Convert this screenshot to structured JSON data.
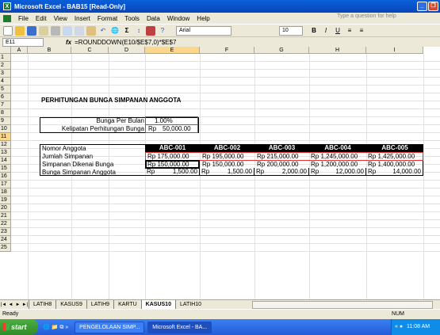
{
  "window": {
    "title": "Microsoft Excel - BAB15  [Read-Only]",
    "app_icon": "excel-icon"
  },
  "menu": {
    "items": [
      "File",
      "Edit",
      "View",
      "Insert",
      "Format",
      "Tools",
      "Data",
      "Window",
      "Help"
    ],
    "help_placeholder": "Type a question for help"
  },
  "toolbar": {
    "font_name": "Arial",
    "font_size": "10",
    "bold": "B",
    "italic": "I",
    "underline": "U"
  },
  "formula_bar": {
    "name_box": "E11",
    "fx": "fx",
    "formula": "=ROUNDDOWN(E10/$E$7,0)*$E$7"
  },
  "columns": [
    "A",
    "B",
    "C",
    "D",
    "E",
    "F",
    "G",
    "H",
    "I"
  ],
  "rows": [
    "1",
    "2",
    "3",
    "4",
    "5",
    "6",
    "7",
    "8",
    "9",
    "10",
    "11",
    "12",
    "13",
    "14",
    "15",
    "16",
    "17",
    "18",
    "19",
    "20",
    "21",
    "22",
    "23",
    "24",
    "25"
  ],
  "sheet": {
    "title": "PERHITUNGAN BUNGA SIMPANAN ANGGOTA",
    "bunga_label": "Bunga Per Bulan",
    "bunga_value": "1.00%",
    "kelipatan_label": "Kelipatan Perhitungan Bunga",
    "kelipatan_prefix": "Rp",
    "kelipatan_value": "50,000.00",
    "row_labels": [
      "Nomor Anggota",
      "Jumlah Simpanan",
      "Simpanan Dikenai Bunga",
      "Bunga Simpanan Anggota"
    ],
    "headers": [
      "ABC-001",
      "ABC-002",
      "ABC-003",
      "ABC-004",
      "ABC-005"
    ],
    "jumlah": [
      "Rp 175,000.00",
      "Rp 195,000.00",
      "Rp 215,000.00",
      "Rp 1,245,000.00",
      "Rp 1,425,000.00"
    ],
    "dikenai": [
      "Rp 150,000.00",
      "Rp 150,000.00",
      "Rp 200,000.00",
      "Rp 1,200,000.00",
      "Rp 1,400,000.00"
    ],
    "bunga_prefix": "Rp",
    "bunga": [
      "1,500.00",
      "1,500.00",
      "2,000.00",
      "12,000.00",
      "14,000.00"
    ]
  },
  "tabs": [
    "LATIH8",
    "KASUS9",
    "LATIH9",
    "KARTU",
    "KASUS10",
    "LATIH10"
  ],
  "active_tab": "KASUS10",
  "status": {
    "ready": "Ready",
    "num": "NUM"
  },
  "taskbar": {
    "start": "start",
    "tasks": [
      "PENGELOLAAN SIMP...",
      "Microsoft Excel - BA..."
    ],
    "clock": "11:08 AM"
  }
}
